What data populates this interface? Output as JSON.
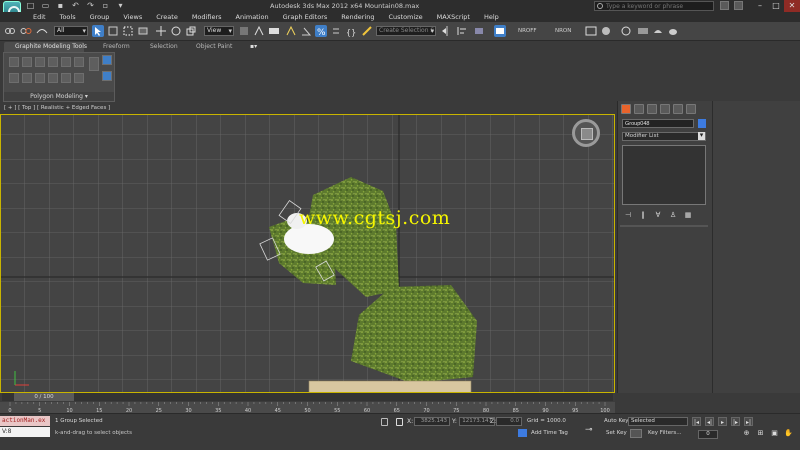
{
  "window": {
    "title": "Autodesk 3ds Max  2012 x64      Mountain08.max",
    "search_placeholder": "Type a keyword or phrase"
  },
  "menu": [
    "Edit",
    "Tools",
    "Group",
    "Views",
    "Create",
    "Modifiers",
    "Animation",
    "Graph Editors",
    "Rendering",
    "Customize",
    "MAXScript",
    "Help"
  ],
  "toolbar": {
    "selection_filter": "All",
    "reference_coord": "View",
    "named_selection_placeholder": "Create Selection S",
    "nrop_label": "NROFF",
    "nron_label": "NRON"
  },
  "ribbon": {
    "tabs": [
      "Graphite Modeling Tools",
      "Freeform",
      "Selection",
      "Object Paint"
    ],
    "panel_label": "Polygon Modeling"
  },
  "viewport": {
    "label": "[ + ] [ Top ] [ Realistic + Edged Faces ]",
    "watermark": "www.cgtsj.com",
    "frame_color": "#c8b400"
  },
  "command_panel": {
    "object_name": "Group048",
    "modifier_list": "Modifier List",
    "object_color": "#3d7be0"
  },
  "timeline": {
    "time_label": "0 / 100",
    "ruler_ticks": [
      "0",
      "5",
      "10",
      "15",
      "20",
      "25",
      "30",
      "35",
      "40",
      "45",
      "50",
      "55",
      "60",
      "65",
      "70",
      "75",
      "80",
      "85",
      "90",
      "95",
      "100"
    ]
  },
  "status": {
    "script_listener": "actionMan.ex",
    "script_input": "V:8",
    "selection": "1 Group Selected",
    "prompt": "k-and-drag to select objects",
    "x_label": "X:",
    "y_label": "Y:",
    "z_label": "Z:",
    "x_value": "3825.143",
    "y_value": "12173.147",
    "z_value": "0.0",
    "grid": "Grid = 1000.0",
    "add_time_tag": "Add Time Tag",
    "auto_key": "Auto Key",
    "set_key": "Set Key",
    "key_mode": "Selected",
    "key_filters": "Key Filters...",
    "frame": "0"
  }
}
